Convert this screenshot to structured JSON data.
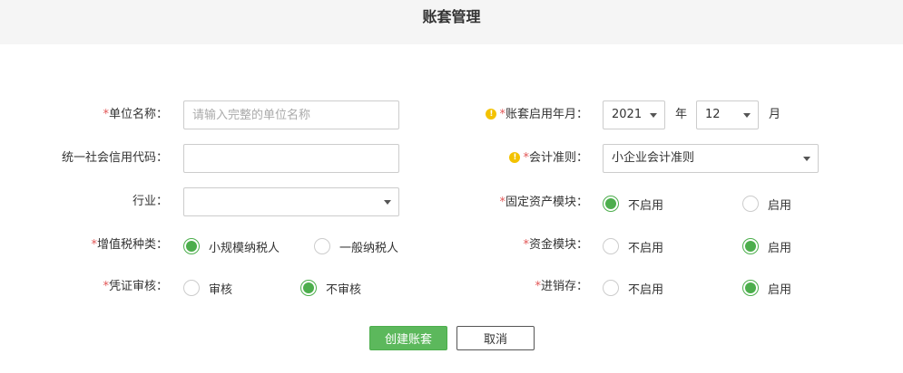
{
  "header": {
    "title": "账套管理"
  },
  "form": {
    "required_mark": "*",
    "warn_mark": "!",
    "colon": "：",
    "unit_name": {
      "label": "单位名称",
      "placeholder": "请输入完整的单位名称",
      "value": ""
    },
    "credit_code": {
      "label": "统一社会信用代码",
      "value": ""
    },
    "industry": {
      "label": "行业",
      "value": ""
    },
    "vat_type": {
      "label": "增值税种类",
      "options": [
        "小规模纳税人",
        "一般纳税人"
      ],
      "selected": "小规模纳税人"
    },
    "voucher_review": {
      "label": "凭证审核",
      "options": [
        "审核",
        "不审核"
      ],
      "selected": "不审核"
    },
    "start_period": {
      "label": "账套启用年月",
      "year": "2021",
      "year_unit": "年",
      "month": "12",
      "month_unit": "月"
    },
    "accounting_standard": {
      "label": "会计准则",
      "value": "小企业会计准则"
    },
    "fixed_assets": {
      "label": "固定资产模块",
      "options": [
        "不启用",
        "启用"
      ],
      "selected": "不启用"
    },
    "funds": {
      "label": "资金模块",
      "options": [
        "不启用",
        "启用"
      ],
      "selected": "启用"
    },
    "inventory": {
      "label": "进销存",
      "options": [
        "不启用",
        "启用"
      ],
      "selected": "启用"
    }
  },
  "actions": {
    "create_label": "创建账套",
    "cancel_label": "取消"
  },
  "colors": {
    "accent": "#5cb85c",
    "required": "#e25656",
    "warning": "#f3c200",
    "header_bg": "#f5f5f5"
  }
}
